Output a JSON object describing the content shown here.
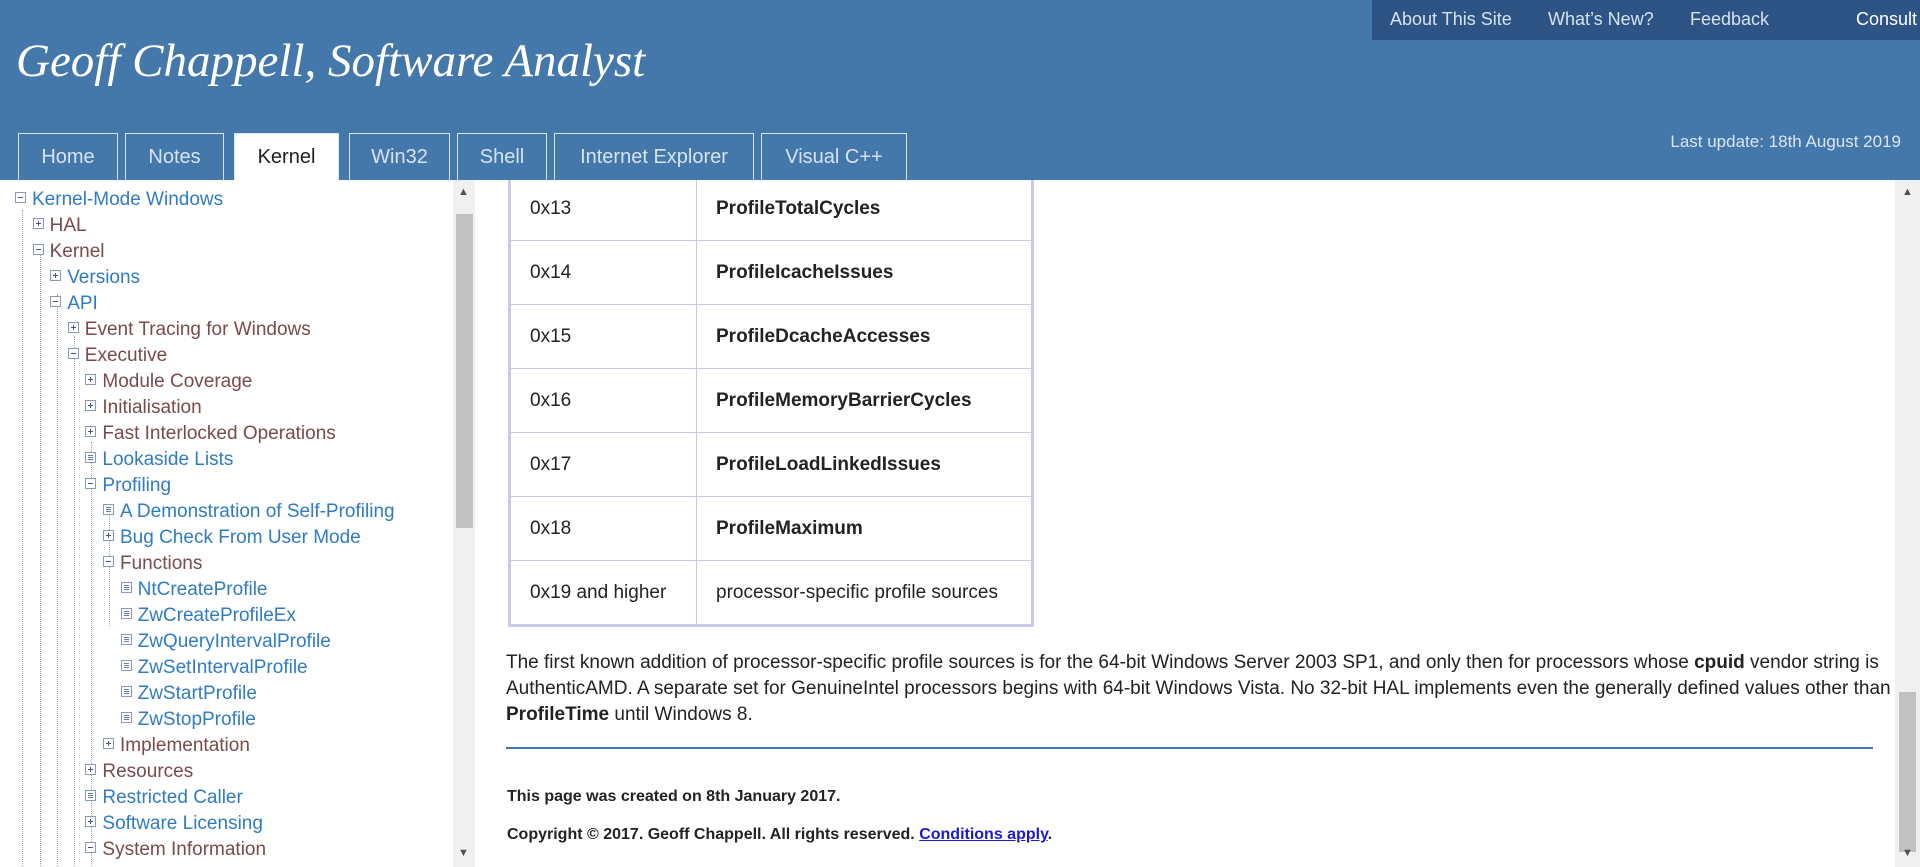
{
  "site": {
    "title": "Geoff Chappell, Software Analyst",
    "last_update": "Last update: 18th August 2019"
  },
  "topnav": {
    "about": "About This Site",
    "whats_new": "What’s New?",
    "feedback": "Feedback",
    "consult": "Consult"
  },
  "tabs": [
    "Home",
    "Notes",
    "Kernel",
    "Win32",
    "Shell",
    "Internet Explorer",
    "Visual C++"
  ],
  "tree": [
    {
      "label": "Kernel-Mode Windows",
      "icon": "minus",
      "color": "blue"
    },
    {
      "label": "HAL",
      "icon": "plus",
      "color": "brown"
    },
    {
      "label": "Kernel",
      "icon": "minus",
      "color": "brown"
    },
    {
      "label": "Versions",
      "icon": "plus",
      "color": "blue"
    },
    {
      "label": "API",
      "icon": "minus",
      "color": "blue"
    },
    {
      "label": "Event Tracing for Windows",
      "icon": "plus",
      "color": "brown"
    },
    {
      "label": "Executive",
      "icon": "minus",
      "color": "brown"
    },
    {
      "label": "Module Coverage",
      "icon": "plus",
      "color": "brown"
    },
    {
      "label": "Initialisation",
      "icon": "plus",
      "color": "brown"
    },
    {
      "label": "Fast Interlocked Operations",
      "icon": "plus",
      "color": "brown"
    },
    {
      "label": "Lookaside Lists",
      "icon": "leaf",
      "color": "blue"
    },
    {
      "label": "Profiling",
      "icon": "minus",
      "color": "blue"
    },
    {
      "label": "A Demonstration of Self-Profiling",
      "icon": "leaf",
      "color": "blue"
    },
    {
      "label": "Bug Check From User Mode",
      "icon": "plus",
      "color": "blue"
    },
    {
      "label": "Functions",
      "icon": "minus",
      "color": "brown"
    },
    {
      "label": "NtCreateProfile",
      "icon": "leaf",
      "color": "blue"
    },
    {
      "label": "ZwCreateProfileEx",
      "icon": "leaf",
      "color": "blue"
    },
    {
      "label": "ZwQueryIntervalProfile",
      "icon": "leaf",
      "color": "blue"
    },
    {
      "label": "ZwSetIntervalProfile",
      "icon": "leaf",
      "color": "blue"
    },
    {
      "label": "ZwStartProfile",
      "icon": "leaf",
      "color": "blue"
    },
    {
      "label": "ZwStopProfile",
      "icon": "leaf",
      "color": "blue"
    },
    {
      "label": "Implementation",
      "icon": "plus",
      "color": "brown"
    },
    {
      "label": "Resources",
      "icon": "plus",
      "color": "brown"
    },
    {
      "label": "Restricted Caller",
      "icon": "leaf",
      "color": "blue"
    },
    {
      "label": "Software Licensing",
      "icon": "plus",
      "color": "blue"
    },
    {
      "label": "System Information",
      "icon": "minus",
      "color": "brown"
    }
  ],
  "table": [
    {
      "value": "0x13",
      "name": "ProfileTotalCycles",
      "bold": true
    },
    {
      "value": "0x14",
      "name": "ProfileIcacheIssues",
      "bold": true
    },
    {
      "value": "0x15",
      "name": "ProfileDcacheAccesses",
      "bold": true
    },
    {
      "value": "0x16",
      "name": "ProfileMemoryBarrierCycles",
      "bold": true
    },
    {
      "value": "0x17",
      "name": "ProfileLoadLinkedIssues",
      "bold": true
    },
    {
      "value": "0x18",
      "name": "ProfileMaximum",
      "bold": true
    },
    {
      "value": "0x19 and higher",
      "name": "processor-specific profile sources",
      "bold": false
    }
  ],
  "paragraph": {
    "p1": "The first known addition of processor-specific profile sources is for the 64-bit Windows Server 2003 SP1, and only then for processors whose ",
    "b1": "cpuid",
    "p2": " vendor string is AuthenticAMD. A separate set for GenuineIntel processors begins with 64-bit Windows Vista. No 32-bit HAL implements even the generally defined values other than ",
    "b2": "ProfileTime",
    "p3": " until Windows 8."
  },
  "footer": {
    "created": "This page was created on 8th January 2017.",
    "copyright": "Copyright © 2017. Geoff Chappell. All rights reserved. ",
    "conditions_link": "Conditions apply",
    "period": "."
  },
  "colors": {
    "header_bg": "#4477aa",
    "topnav_bg": "#2d5485",
    "tree_link": "#2f7bc4",
    "tree_text": "#7a4a4a",
    "table_border": "#c9c9ec"
  }
}
